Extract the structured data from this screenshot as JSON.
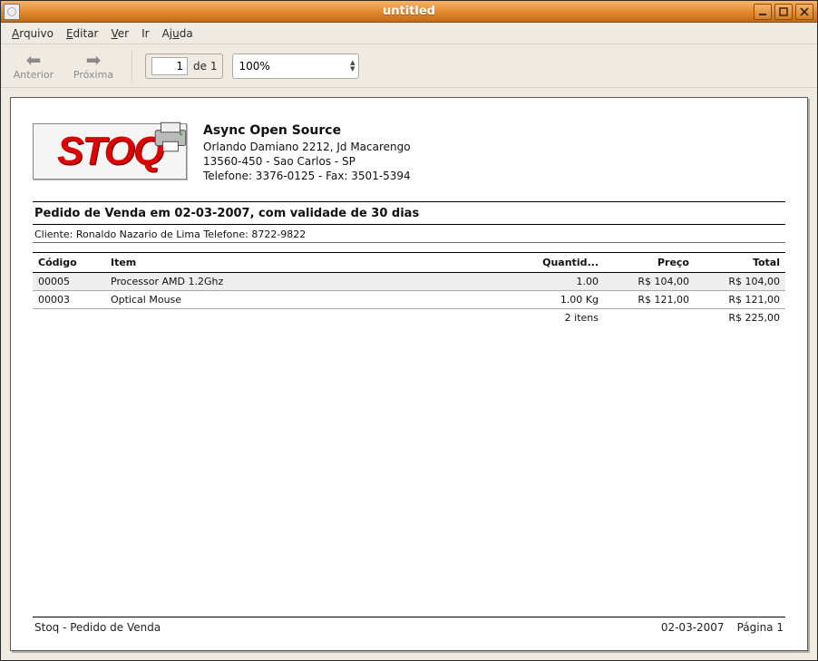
{
  "window": {
    "title": "untitled"
  },
  "menu": {
    "arquivo": "Arquivo",
    "editar": "Editar",
    "ver": "Ver",
    "ir": "Ir",
    "ajuda": "Ajuda"
  },
  "toolbar": {
    "prev_label": "Anterior",
    "next_label": "Próxima",
    "page_value": "1",
    "page_of_prefix": "de",
    "page_total": "1",
    "zoom_value": "100%"
  },
  "document": {
    "company": {
      "name": "Async Open Source",
      "address": "Orlando Damiano 2212, Jd Macarengo",
      "city": "13560-450 - Sao Carlos - SP",
      "phone": "Telefone: 3376-0125 - Fax: 3501-5394"
    },
    "logo_text": "STOQ",
    "title": "Pedido de Venda em 02-03-2007, com validade de 30 dias",
    "client_line": "Cliente: Ronaldo Nazario de Lima Telefone: 8722-9822",
    "columns": {
      "codigo": "Código",
      "item": "Item",
      "quantidade": "Quantid...",
      "preco": "Preço",
      "total": "Total"
    },
    "rows": [
      {
        "codigo": "00005",
        "item": "Processor AMD 1.2Ghz",
        "qtd": "1.00",
        "preco": "R$ 104,00",
        "total": "R$ 104,00"
      },
      {
        "codigo": "00003",
        "item": "Optical Mouse",
        "qtd": "1.00 Kg",
        "preco": "R$ 121,00",
        "total": "R$ 121,00"
      }
    ],
    "summary": {
      "count_text": "2 itens",
      "total": "R$ 225,00"
    },
    "footer": {
      "left": "Stoq - Pedido de Venda",
      "date": "02-03-2007",
      "page": "Página  1"
    }
  }
}
